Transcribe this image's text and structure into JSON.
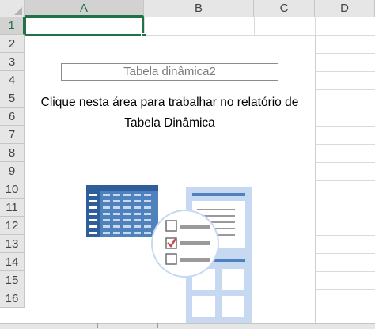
{
  "sheet": {
    "columns": [
      {
        "label": "A",
        "selected": true
      },
      {
        "label": "B",
        "selected": false
      },
      {
        "label": "C",
        "selected": false
      },
      {
        "label": "D",
        "selected": false
      }
    ],
    "rows": [
      "1",
      "2",
      "3",
      "4",
      "5",
      "6",
      "7",
      "8",
      "9",
      "10",
      "11",
      "12",
      "13",
      "14",
      "15",
      "16"
    ],
    "selected_cell": "A1"
  },
  "pivot": {
    "name": "Tabela dinâmica2",
    "instruction_line1": "Clique nesta área para trabalhar no relatório de",
    "instruction_line2": "Tabela Dinâmica"
  },
  "colors": {
    "accent": "#217346",
    "illustration_blue": "#4f81bd",
    "illustration_light_blue": "#c6d9f1",
    "check_red": "#c0504d"
  },
  "icons": [
    "table-icon",
    "field-list-icon",
    "checkbox-list-icon"
  ]
}
